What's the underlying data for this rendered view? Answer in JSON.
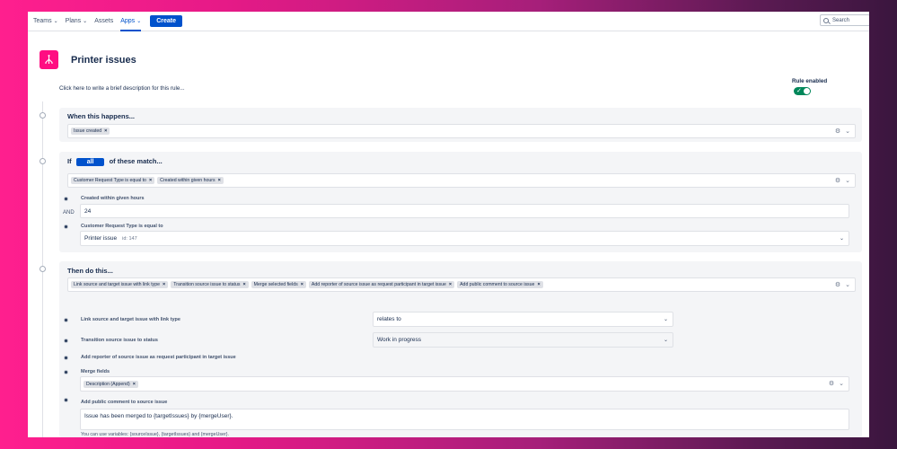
{
  "nav": {
    "items": [
      {
        "label": "Teams",
        "chevron": true
      },
      {
        "label": "Plans",
        "chevron": true
      },
      {
        "label": "Assets",
        "chevron": false
      },
      {
        "label": "Apps",
        "chevron": true,
        "active": true
      }
    ],
    "create_label": "Create",
    "search_placeholder": "Search"
  },
  "rule": {
    "title": "Printer issues",
    "description": "Click here to write a brief description for this rule...",
    "enabled_label": "Rule enabled",
    "enabled": true
  },
  "trigger": {
    "title": "When this happens...",
    "chips": [
      "Issue created"
    ]
  },
  "condition": {
    "prefix": "If",
    "mode": "all",
    "suffix": "of these match...",
    "chips": [
      "Customer Request Type is equal to",
      "Created within given hours"
    ],
    "join": "AND",
    "created_within": {
      "label": "Created within given hours",
      "value": "24"
    },
    "request_type": {
      "label": "Customer Request Type is equal to",
      "value": "Printer issue",
      "id": "id: 147"
    }
  },
  "action": {
    "title": "Then do this...",
    "chips": [
      "Link source and target issue with link type",
      "Transition source issue to status",
      "Merge selected fields",
      "Add reporter of source issue as request participant in target issue",
      "Add public comment to source issue"
    ],
    "link_type": {
      "label": "Link source and target issue with link type",
      "value": "relates to"
    },
    "transition": {
      "label": "Transition source issue to status",
      "value": "Work in progress"
    },
    "add_reporter": {
      "label": "Add reporter of source issue as request participant in target issue"
    },
    "merge_fields": {
      "label": "Merge fields",
      "chips": [
        "Description (Append)"
      ]
    },
    "comment": {
      "label": "Add public comment to source issue",
      "value": "Issue has been merged to {targetIssues} by {mergeUser}.",
      "hint": "You can use variables: {sourceIssue}, {targetIssues} and {mergeUser}."
    }
  },
  "colors": {
    "accent": "#0052cc",
    "toggle_on": "#00875a",
    "rule_icon": "#ff0e82"
  },
  "icons": [
    "rule-branch-icon",
    "search-icon",
    "gear-icon",
    "chevron-down-icon",
    "remove-icon",
    "check-icon"
  ]
}
